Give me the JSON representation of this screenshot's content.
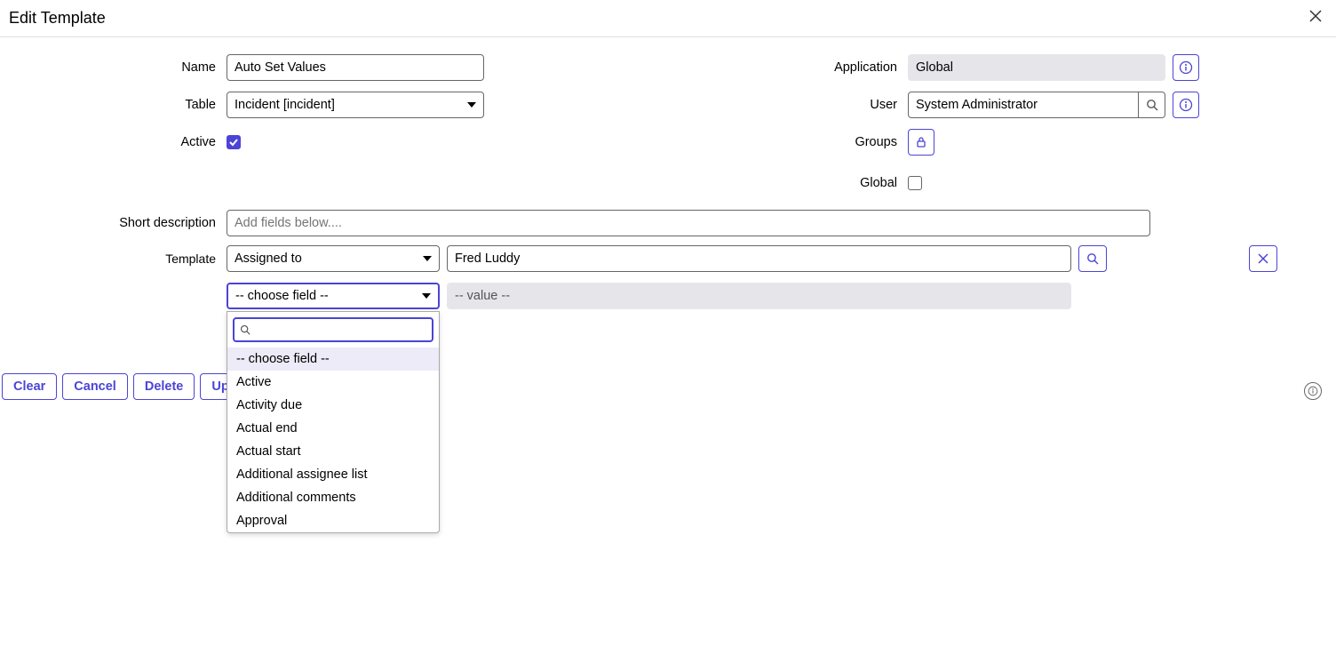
{
  "header": {
    "title": "Edit Template"
  },
  "labels": {
    "name": "Name",
    "table": "Table",
    "active": "Active",
    "application": "Application",
    "user": "User",
    "groups": "Groups",
    "global": "Global",
    "short_description": "Short description",
    "template": "Template"
  },
  "fields": {
    "name": "Auto Set Values",
    "table": "Incident [incident]",
    "active": true,
    "application": "Global",
    "user": "System Administrator",
    "global_checked": false,
    "short_description_placeholder": "Add fields below...."
  },
  "template_rows": [
    {
      "field": "Assigned to",
      "value": "Fred Luddy"
    },
    {
      "field": "-- choose field --",
      "value_placeholder": "-- value --"
    }
  ],
  "dropdown": {
    "options": [
      "-- choose field --",
      "Active",
      "Activity due",
      "Actual end",
      "Actual start",
      "Additional assignee list",
      "Additional comments",
      "Approval"
    ],
    "selected": "-- choose field --"
  },
  "buttons": {
    "clear": "Clear",
    "cancel": "Cancel",
    "delete": "Delete",
    "update": "Update"
  }
}
